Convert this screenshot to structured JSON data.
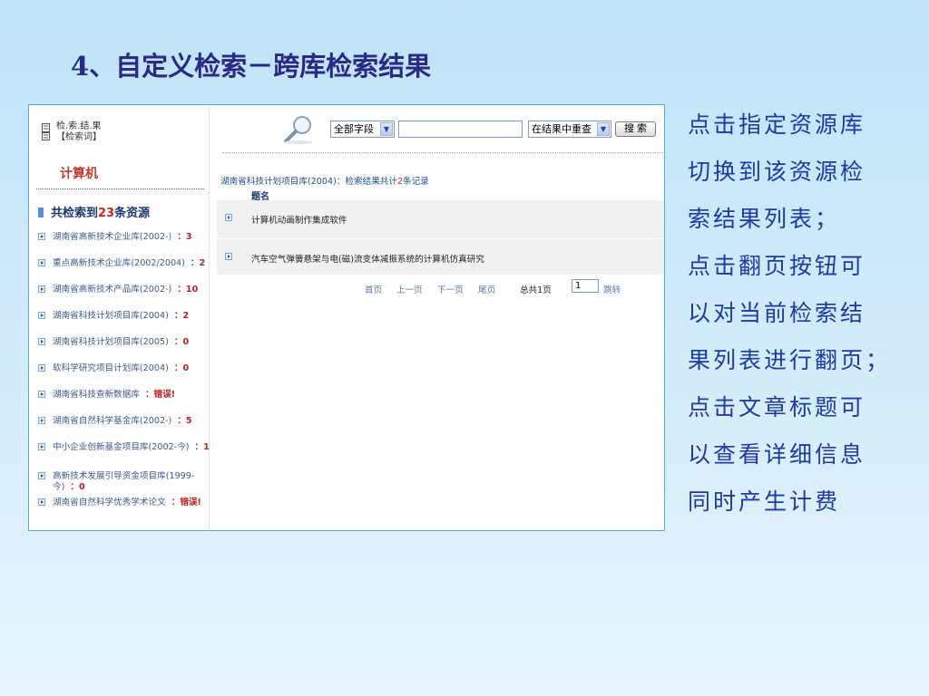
{
  "slide": {
    "title": "4、自定义检索－跨库检索结果",
    "notes": [
      "点击指定资源库",
      "切换到该资源检",
      "索结果列表；",
      "点击翻页按钮可",
      "以对当前检索结",
      "果列表进行翻页；",
      "点击文章标题可",
      "以查看详细信息",
      "同时产生计费"
    ]
  },
  "screenshot": {
    "header_line1": "检.索.结.果",
    "header_line2": "【检索词】",
    "keyword": "计算机",
    "total_prefix": "共检索到",
    "total_count": "23",
    "total_suffix": "条资源",
    "databases": [
      {
        "name": "湖南省高新技术企业库(2002-)",
        "count": "3"
      },
      {
        "name": "重点高新技术企业库(2002/2004)",
        "count": "2"
      },
      {
        "name": "湖南省高新技术产品库(2002-)",
        "count": "10"
      },
      {
        "name": "湖南省科技计划项目库(2004)",
        "count": "2"
      },
      {
        "name": "湖南省科技计划项目库(2005)",
        "count": "0"
      },
      {
        "name": "软科学研究项目计划库(2004)",
        "count": "0"
      },
      {
        "name": "湖南省科技查新数据库",
        "count": "错误!"
      },
      {
        "name": "湖南省自然科学基金库(2002-)",
        "count": "5"
      },
      {
        "name": "中小企业创新基金项目库(2002-今)",
        "count": "1"
      },
      {
        "name": "高新技术发展引导资金项目库(1999-今)",
        "count": "0"
      },
      {
        "name": "湖南省自然科学优秀学术论文",
        "count": "错误!"
      }
    ],
    "search": {
      "field_select": "全部字段",
      "keyword_value": "",
      "scope_select": "在结果中重查",
      "button": "搜 索"
    },
    "results": {
      "db_name": "湖南省科技计划项目库(2004)：检索结果共计",
      "count": "2",
      "unit": "条记录",
      "column_title": "题名",
      "rows": [
        "计算机动画制作集成软件",
        "汽车空气弹簧悬架与电(磁)流变体减振系统的计算机仿真研究"
      ]
    },
    "pager": {
      "first": "首页",
      "prev": "上一页",
      "next": "下一页",
      "last": "尾页",
      "total_pages": "总共1页",
      "page_value": "1",
      "jump": "跳转"
    }
  }
}
